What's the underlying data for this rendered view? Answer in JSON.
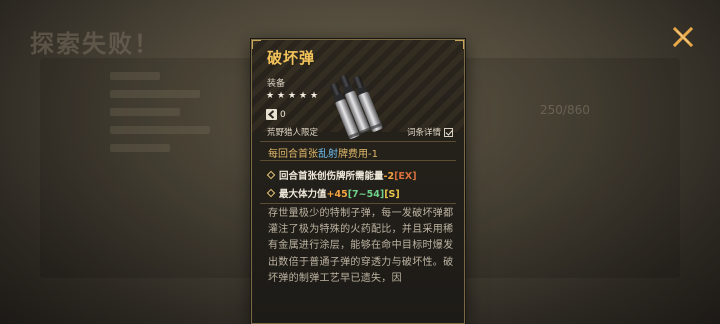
{
  "background": {
    "title": "探索失败！",
    "counter": "250/860"
  },
  "card": {
    "name": "破坏弹",
    "type": "装备",
    "stars": [
      "★",
      "★",
      "★",
      "★",
      "★"
    ],
    "cost": "0",
    "restriction": "荒野猎人限定",
    "detail_toggle": {
      "label": "词条详情",
      "checked": true
    },
    "effect_main": {
      "prefix": "每回合首张",
      "keyword": "乱射",
      "suffix": "牌费用-1"
    },
    "effects": [
      {
        "text": "回合首张创伤牌所需能量",
        "value": "-2",
        "tag": "[EX]"
      },
      {
        "text": "最大体力值",
        "value": "+45",
        "range": "[7~54]",
        "tag": "[S]"
      }
    ],
    "lore": "存世量极少的特制子弹，每一发破坏弹都灌注了极为特殊的火药配比，并且采用稀有金属进行涂层，能够在命中目标时爆发出数倍于普通子弹的穿透力与破坏性。破坏弹的制弹工艺早已遗失，因"
  },
  "colors": {
    "title": "#f2c35a",
    "keyword": "#6fc0f0",
    "value_orange": "#f0a340",
    "range_green": "#6fd08a",
    "tag_yellow": "#e8c64a",
    "close": "#e8a94a"
  },
  "icons": {
    "close": "close-x-icon",
    "cost": "energy-cost-icon",
    "checkbox": "checkbox-checked-icon",
    "art": "bullet-cartridge-art"
  }
}
